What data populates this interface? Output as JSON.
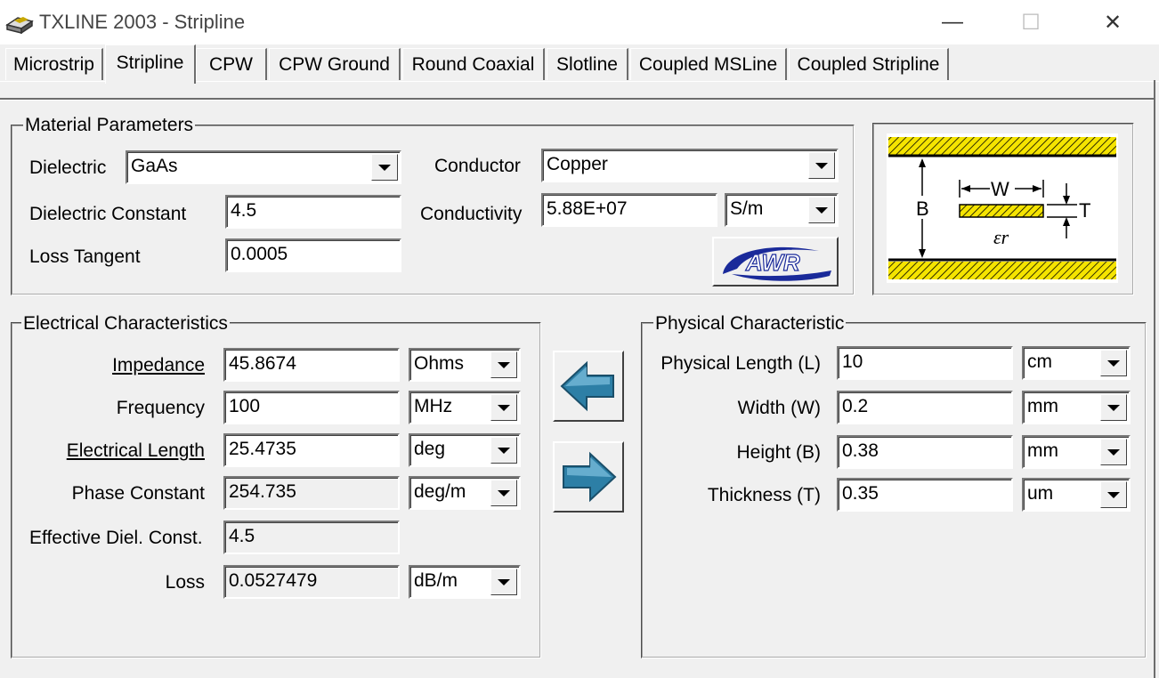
{
  "window": {
    "title": "TXLINE 2003 - Stripline",
    "minimize": "—",
    "maximize": "☐",
    "close": "✕"
  },
  "tabs": [
    {
      "label": "Microstrip"
    },
    {
      "label": "Stripline"
    },
    {
      "label": "CPW"
    },
    {
      "label": "CPW Ground"
    },
    {
      "label": "Round Coaxial"
    },
    {
      "label": "Slotline"
    },
    {
      "label": "Coupled MSLine"
    },
    {
      "label": "Coupled Stripline"
    }
  ],
  "material": {
    "title": "Material Parameters",
    "dielectric_label": "Dielectric",
    "dielectric_value": "GaAs",
    "dielectric_constant_label": "Dielectric Constant",
    "dielectric_constant_value": "4.5",
    "loss_tangent_label": "Loss Tangent",
    "loss_tangent_value": "0.0005",
    "conductor_label": "Conductor",
    "conductor_value": "Copper",
    "conductivity_label": "Conductivity",
    "conductivity_value": "5.88E+07",
    "conductivity_unit": "S/m",
    "logo_text": "AWR"
  },
  "diagram": {
    "b_label": "B",
    "w_label": "W",
    "t_label": "T",
    "er_label": "εr",
    "colors": {
      "metal": "#f5e400",
      "line": "#000000"
    }
  },
  "electrical": {
    "title": "Electrical Characteristics",
    "rows": [
      {
        "label": "Impedance",
        "value": "45.8674",
        "unit": "Ohms"
      },
      {
        "label": "Frequency",
        "value": "100",
        "unit": "MHz"
      },
      {
        "label": "Electrical Length",
        "value": "25.4735",
        "unit": "deg"
      },
      {
        "label": "Phase Constant",
        "value": "254.735",
        "unit": "deg/m"
      },
      {
        "label": "Effective Diel. Const.",
        "value": "4.5",
        "unit": ""
      },
      {
        "label": "Loss",
        "value": "0.0527479",
        "unit": "dB/m"
      }
    ]
  },
  "physical": {
    "title": "Physical Characteristic",
    "rows": [
      {
        "label": "Physical Length (L)",
        "value": "10",
        "unit": "cm"
      },
      {
        "label": "Width (W)",
        "value": "0.2",
        "unit": "mm"
      },
      {
        "label": "Height (B)",
        "value": "0.38",
        "unit": "mm"
      },
      {
        "label": "Thickness (T)",
        "value": "0.35",
        "unit": "um"
      }
    ]
  },
  "colors": {
    "arrow_fill": "#2d7fa6",
    "arrow_dark": "#1a4f6a",
    "awr_blue": "#1a2a9a"
  }
}
